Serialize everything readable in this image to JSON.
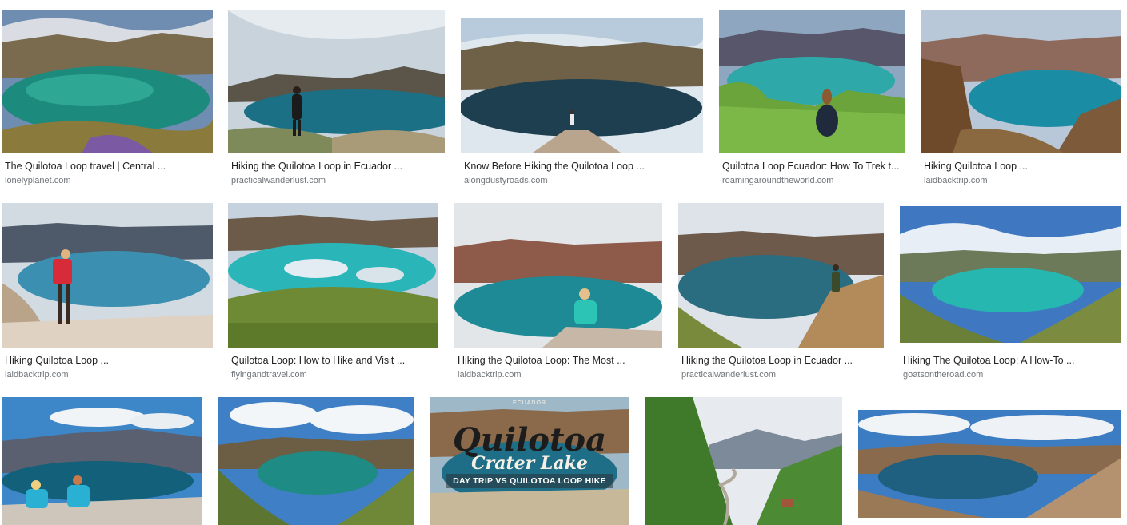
{
  "results": [
    {
      "title": "The Quilotoa Loop travel | Central ...",
      "source": "lonelyplanet.com",
      "image": "crater-lake-turquoise-flowers"
    },
    {
      "title": "Hiking the Quilotoa Loop in Ecuador ...",
      "source": "practicalwanderlust.com",
      "image": "crater-lake-hiker-clouds"
    },
    {
      "title": "Know Before Hiking the Quilotoa Loop ...",
      "source": "alongdustyroads.com",
      "image": "crater-lake-hiker-on-rock"
    },
    {
      "title": "Quilotoa Loop Ecuador: How To Trek t...",
      "source": "roamingaroundtheworld.com",
      "image": "crater-lake-person-sitting-grass"
    },
    {
      "title": "Hiking Quilotoa Loop ...",
      "source": "laidbacktrip.com",
      "image": "crater-lake-shrubs"
    },
    {
      "title": "Hiking Quilotoa Loop ...",
      "source": "laidbacktrip.com",
      "image": "crater-lake-hiker-red-backpack"
    },
    {
      "title": "Quilotoa Loop: How to Hike and Visit ...",
      "source": "flyingandtravel.com",
      "image": "crater-lake-reflection"
    },
    {
      "title": "Hiking the Quilotoa Loop: The Most ...",
      "source": "laidbacktrip.com",
      "image": "crater-lake-person-teal-jacket"
    },
    {
      "title": "Hiking the Quilotoa Loop in Ecuador ...",
      "source": "practicalwanderlust.com",
      "image": "crater-lake-hiker-ridge"
    },
    {
      "title": "Hiking The Quilotoa Loop: A How-To ...",
      "source": "goatsontheroad.com",
      "image": "crater-lake-wide-view"
    },
    {
      "title": "",
      "source": "",
      "image": "crater-lake-two-hikers-sitting"
    },
    {
      "title": "",
      "source": "",
      "image": "crater-lake-blue-sky"
    },
    {
      "title": "",
      "source": "",
      "image": "crater-lake-poster",
      "overlay": {
        "country": "ECUADOR",
        "title": "Quilotoa",
        "subtitle": "Crater Lake",
        "band": "DAY TRIP VS QUILOTOA LOOP HIKE"
      }
    },
    {
      "title": "",
      "source": "",
      "image": "green-valley-road"
    },
    {
      "title": "",
      "source": "",
      "image": "crater-lake-panorama"
    }
  ]
}
